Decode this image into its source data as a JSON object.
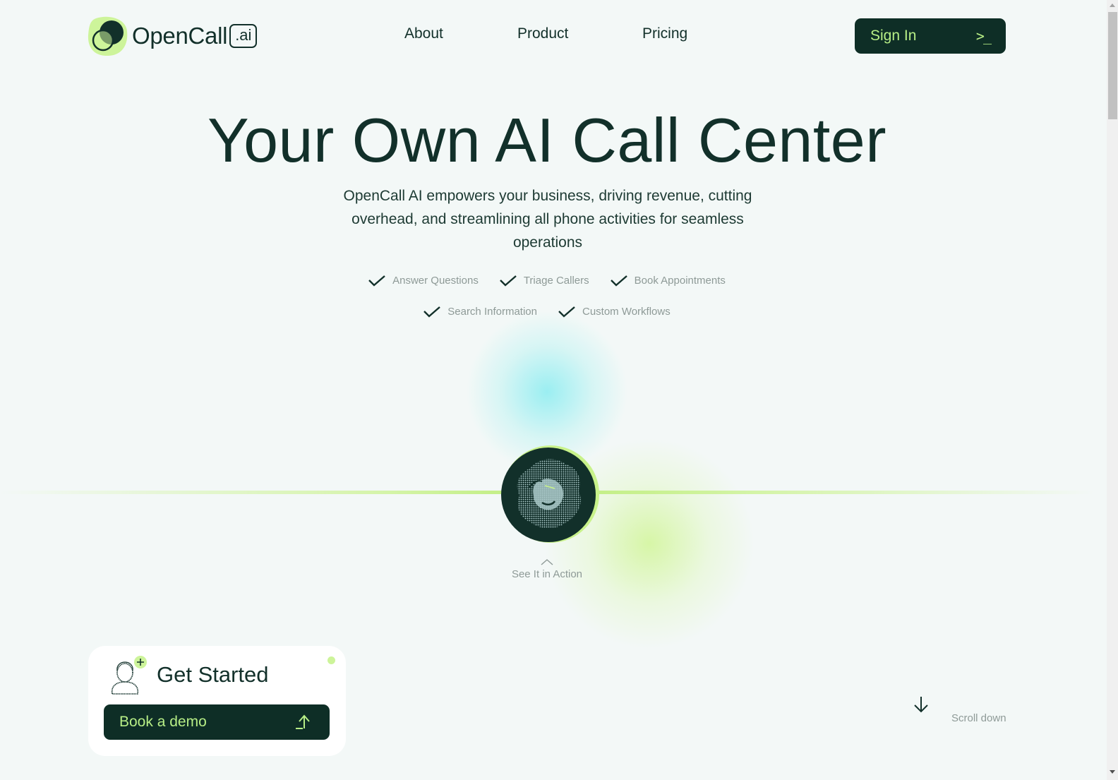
{
  "header": {
    "logo_text": "OpenCall",
    "logo_badge": ".ai",
    "nav": [
      {
        "label": "About"
      },
      {
        "label": "Product"
      },
      {
        "label": "Pricing"
      }
    ],
    "signin": {
      "label": "Sign In",
      "icon": "terminal-prompt-icon",
      "glyph": ">_"
    }
  },
  "hero": {
    "title": "Your Own AI Call Center",
    "subtitle": "OpenCall AI empowers your business, driving revenue, cutting overhead, and streamlining all phone activities for seamless operations",
    "features_row1": [
      "Answer Questions",
      "Triage Callers",
      "Book Appointments"
    ],
    "features_row2": [
      "Search Information",
      "Custom Workflows"
    ],
    "see_action_label": "See It in Action"
  },
  "get_started": {
    "title": "Get Started",
    "button_label": "Book a demo"
  },
  "scroll": {
    "label": "Scroll down"
  },
  "colors": {
    "brand_dark": "#0e2e26",
    "accent_green": "#b7ee86",
    "background": "#f3f8f7",
    "muted_text": "#8e9a97"
  }
}
